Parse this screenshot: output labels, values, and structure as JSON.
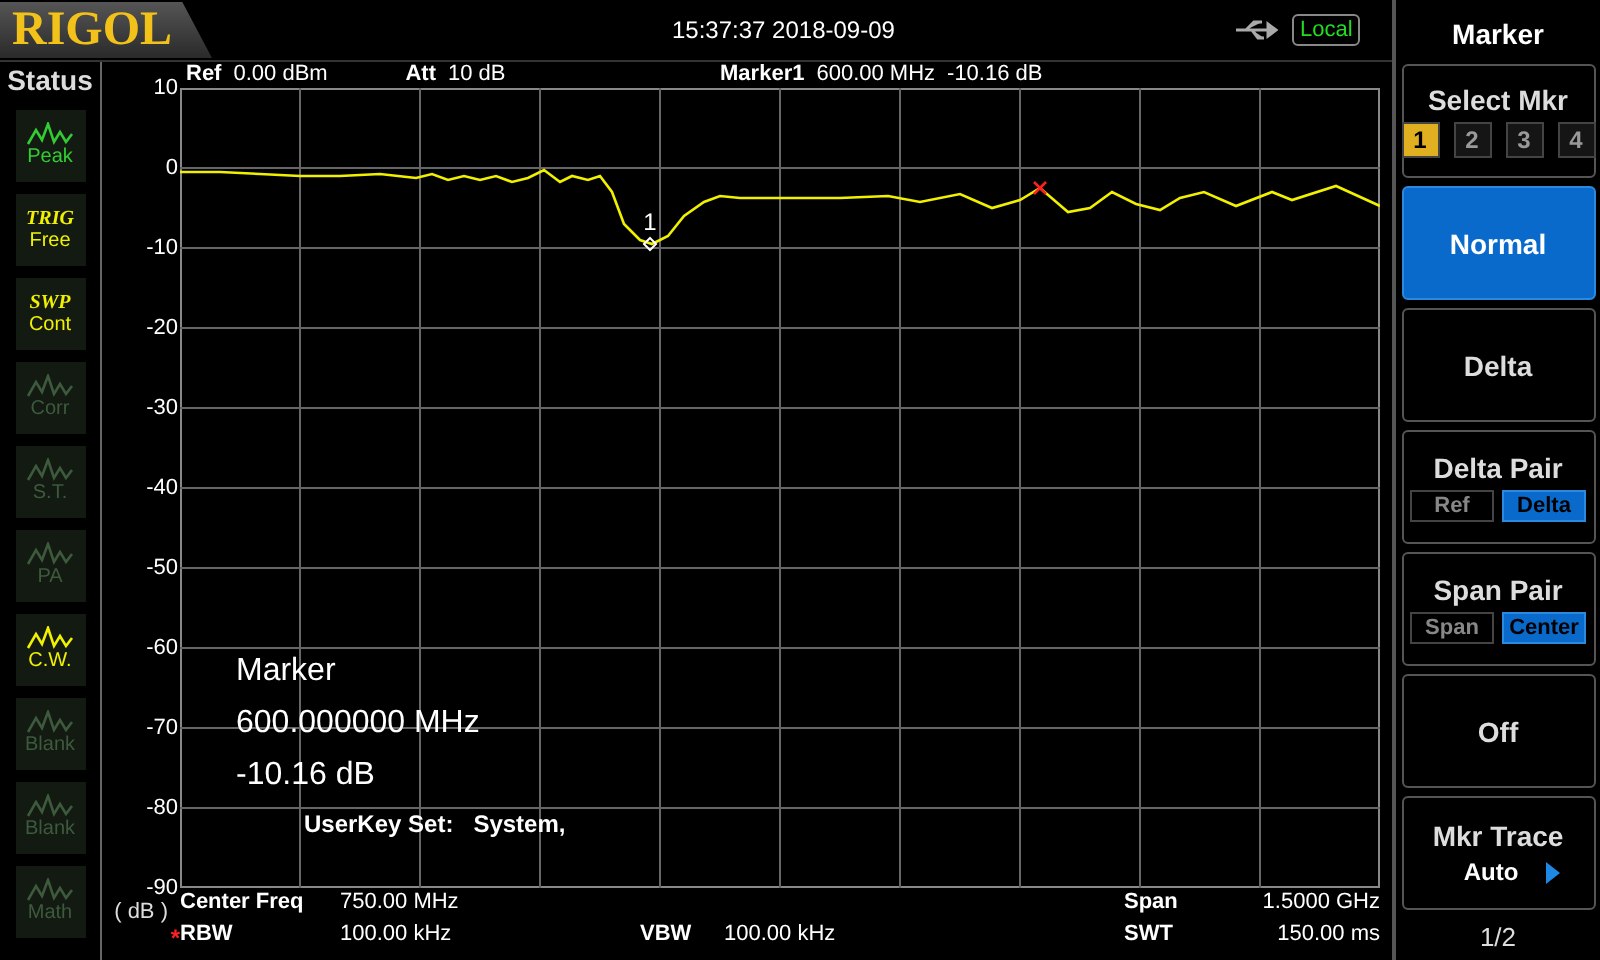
{
  "header": {
    "logo": "RIGOL",
    "datetime": "15:37:37 2018-09-09",
    "remote": "Local"
  },
  "status": {
    "title": "Status",
    "items": [
      {
        "kind": "icon",
        "label": "Peak",
        "color": "#33cc33"
      },
      {
        "kind": "text",
        "title": "TRIG",
        "label": "Free",
        "color": "#f0f000"
      },
      {
        "kind": "text",
        "title": "SWP",
        "label": "Cont",
        "color": "#f0f000"
      },
      {
        "kind": "icon",
        "label": "Corr",
        "color": "#3d5a3d"
      },
      {
        "kind": "icon",
        "label": "S.T.",
        "color": "#3d5a3d"
      },
      {
        "kind": "icon",
        "label": "PA",
        "color": "#3d5a3d"
      },
      {
        "kind": "icon",
        "label": "C.W.",
        "color": "#f0f000"
      },
      {
        "kind": "icon",
        "label": "Blank",
        "color": "#3d5a3d"
      },
      {
        "kind": "icon",
        "label": "Blank",
        "color": "#3d5a3d"
      },
      {
        "kind": "icon",
        "label": "Math",
        "color": "#3d5a3d"
      }
    ]
  },
  "plot": {
    "ref_label": "Ref",
    "ref": "0.00 dBm",
    "att_label": "Att",
    "att": "10 dB",
    "marker_label": "Marker1",
    "marker_freq": "600.00 MHz",
    "marker_amp": "-10.16 dB",
    "y_labels": [
      "10",
      "0",
      "-10",
      "-20",
      "-30",
      "-40",
      "-50",
      "-60",
      "-70",
      "-80",
      "-90"
    ],
    "unit": "( dB )",
    "marker_number": "1",
    "readout": [
      "Marker",
      "600.000000 MHz",
      "-10.16 dB"
    ],
    "userkey": "UserKey Set:   System,",
    "info": [
      {
        "label": "Center Freq",
        "value": "750.00 MHz"
      },
      {
        "label": "Span",
        "value": "1.5000 GHz"
      },
      {
        "label": "RBW",
        "value": "100.00 kHz",
        "flag": "*"
      },
      {
        "label": "VBW",
        "value": "100.00 kHz"
      },
      {
        "label": "SWT",
        "value": "150.00 ms"
      }
    ]
  },
  "menu": {
    "title": "Marker",
    "page": "1/2",
    "keys": [
      {
        "kind": "select",
        "label": "Select Mkr",
        "options": [
          {
            "label": "1",
            "selected": true
          },
          {
            "label": "2",
            "selected": false
          },
          {
            "label": "3",
            "selected": false
          },
          {
            "label": "4",
            "selected": false
          }
        ]
      },
      {
        "kind": "plain",
        "label": "Normal",
        "selected": true
      },
      {
        "kind": "plain",
        "label": "Delta",
        "selected": false
      },
      {
        "kind": "pair",
        "label": "Delta Pair",
        "options": [
          {
            "label": "Ref",
            "selected": false
          },
          {
            "label": "Delta",
            "selected": true
          }
        ]
      },
      {
        "kind": "pair",
        "label": "Span Pair",
        "options": [
          {
            "label": "Span",
            "selected": false
          },
          {
            "label": "Center",
            "selected": true
          }
        ]
      },
      {
        "kind": "plain",
        "label": "Off",
        "selected": false
      },
      {
        "kind": "value",
        "label": "Mkr Trace",
        "value": "Auto"
      }
    ]
  }
}
